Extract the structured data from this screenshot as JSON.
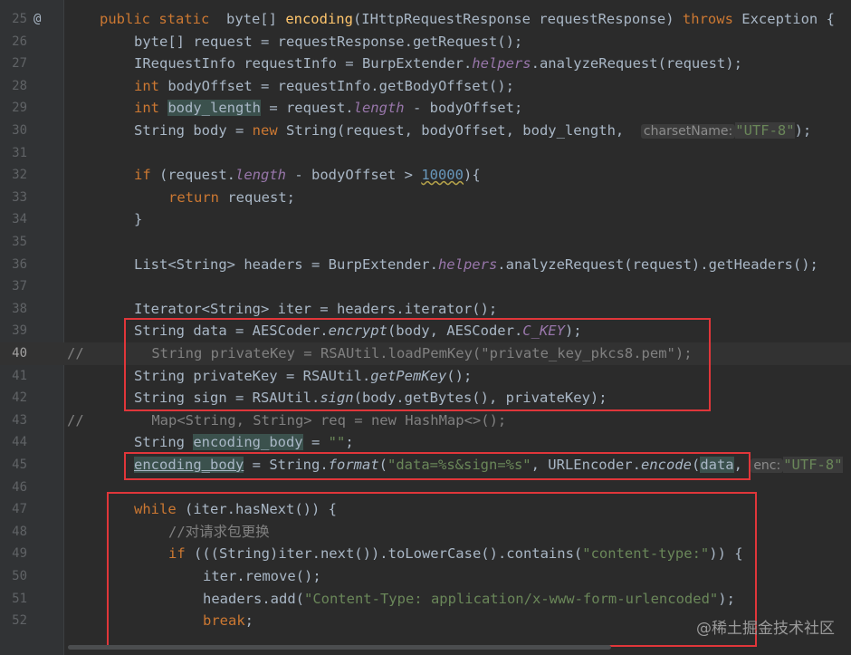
{
  "line_numbers": [
    "25",
    "26",
    "27",
    "28",
    "29",
    "30",
    "31",
    "32",
    "33",
    "34",
    "35",
    "36",
    "37",
    "38",
    "39",
    "40",
    "41",
    "42",
    "43",
    "44",
    "45",
    "46",
    "47",
    "48",
    "49",
    "50",
    "51",
    "52"
  ],
  "gutter_marker": "@",
  "lines": {
    "l25": {
      "kw1": "public static  ",
      "t1": "byte[] ",
      "fn": "encoding",
      "t2": "(IHttpRequestResponse requestResponse) ",
      "kw2": "throws",
      "t3": " Exception {"
    },
    "l26": {
      "t1": "byte[] request = requestResponse.getRequest();"
    },
    "l27": {
      "t1": "IRequestInfo requestInfo = BurpExtender.",
      "it": "helpers",
      "t2": ".analyzeRequest(request);"
    },
    "l28": {
      "kw": "int ",
      "t1": "bodyOffset = requestInfo.getBodyOffset();"
    },
    "l29": {
      "kw": "int ",
      "hl": "body_length",
      "t1": " = request.",
      "it": "length",
      "t2": " - bodyOffset;"
    },
    "l30": {
      "t1": "String body = ",
      "kw": "new ",
      "t2": "String(request, bodyOffset, body_length,  ",
      "hint": "charsetName:",
      "str": "\"UTF-8\"",
      "t3": ");"
    },
    "l32": {
      "kw": "if ",
      "t1": "(request.",
      "it": "length",
      "t2": " - bodyOffset > ",
      "num": "10000",
      "t3": "){"
    },
    "l33": {
      "kw": "return ",
      "t1": "request;"
    },
    "l34": {
      "t1": "}"
    },
    "l36": {
      "t1": "List<String> headers = BurpExtender.",
      "it": "helpers",
      "t2": ".analyzeRequest(request).getHeaders();"
    },
    "l38": {
      "t1": "Iterator<String> iter = headers.iterator();"
    },
    "l39": {
      "t1": "String data = AESCoder.",
      "st": "encrypt",
      "t2": "(body, AESCoder.",
      "it": "C_KEY",
      "t3": ");"
    },
    "l40": {
      "cmt": "//        String privateKey = RSAUtil.loadPemKey(\"private_key_pkcs8.pem\");"
    },
    "l41": {
      "t1": "String privateKey = RSAUtil.",
      "st": "getPemKey",
      "t2": "();"
    },
    "l42": {
      "t1": "String sign = RSAUtil.",
      "st": "sign",
      "t2": "(body.getBytes(), privateKey);"
    },
    "l43": {
      "cmt": "//        Map<String, String> req = new HashMap<>();"
    },
    "l44": {
      "t1": "String ",
      "hl": "encoding_body",
      "t2": " = ",
      "str": "\"\"",
      "t3": ";"
    },
    "l45": {
      "hl": "encoding_body",
      "t1": " = String.",
      "st": "format",
      "t2": "(",
      "str": "\"data=%s&sign=%s\"",
      "t3": ", URLEncoder.",
      "st2": "encode",
      "t4": "(",
      "hl2": "data",
      "t5": ", ",
      "hint": "enc:",
      "str2": "\"UTF-8\""
    },
    "l47": {
      "kw": "while ",
      "t1": "(iter.hasNext()) {"
    },
    "l48": {
      "cmt": "//对请求包更换"
    },
    "l49": {
      "kw": "if ",
      "t1": "(((String)iter.next()).toLowerCase().contains(",
      "str": "\"content-type:\"",
      "t2": ")) {"
    },
    "l50": {
      "t1": "iter.remove();"
    },
    "l51": {
      "t1": "headers.add(",
      "str": "\"Content-Type: application/x-www-form-urlencoded\"",
      "t2": ");"
    },
    "l52": {
      "kw": "break",
      "t1": ";"
    }
  },
  "watermark": "@稀土掘金技术社区",
  "colors": {
    "background": "#2b2b2b",
    "keyword": "#cc7832",
    "string": "#6a8759",
    "annotation_box": "#e0363a"
  }
}
